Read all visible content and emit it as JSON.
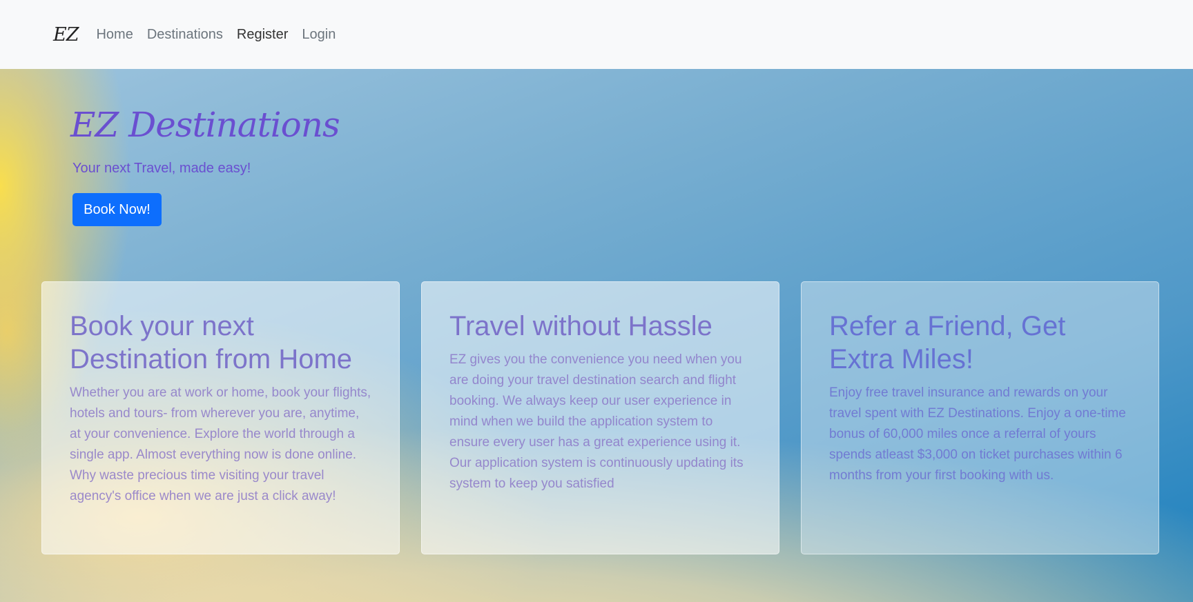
{
  "nav": {
    "brand": "EZ",
    "links": [
      "Home",
      "Destinations",
      "Register",
      "Login"
    ]
  },
  "hero": {
    "title": "EZ Destinations",
    "subtitle": "Your next Travel, made easy!",
    "cta_label": "Book Now!"
  },
  "cards": [
    {
      "title": "Book your next Destination from Home",
      "body": "Whether you are at work or home, book your flights, hotels and tours- from wherever you are, anytime, at your convenience. Explore the world through a single app. Almost everything now is done online. Why waste precious time visiting your travel agency's office when we are just a click away!"
    },
    {
      "title": "Travel without Hassle",
      "body": "EZ gives you the convenience you need when you are doing your travel destination search and flight booking. We always keep our user experience in mind when we build the application system to ensure every user has a great experience using it. Our application system is continuously updating its system to keep you satisfied"
    },
    {
      "title": "Refer a Friend, Get Extra Miles!",
      "body": "Enjoy free travel insurance and rewards on your travel spent with EZ Destinations. Enjoy a one-time bonus of 60,000 miles once a referral of yours spends atleast $3,000 on ticket purchases within 6 months from your first booking with us."
    }
  ],
  "colors": {
    "accent": "#6a4fd0",
    "button": "#0d6efd",
    "navbar_bg": "#f8f9fa"
  }
}
